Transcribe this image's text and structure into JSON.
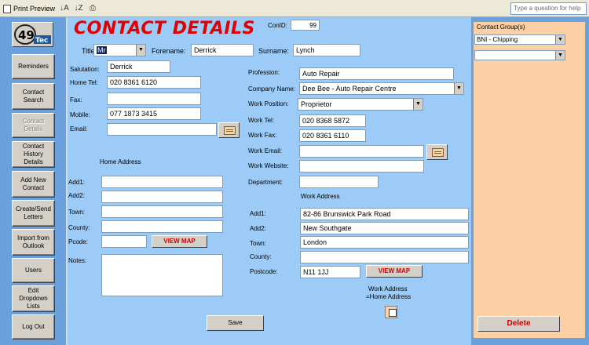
{
  "toolbar": {
    "print_preview": "Print Preview",
    "sort_asc_icon": "sort-ascending-icon",
    "sort_desc_icon": "sort-descending-icon",
    "printer_icon": "printer-icon",
    "help_placeholder": "Type a question for help"
  },
  "logo": {
    "number": "49",
    "text": "Tec"
  },
  "nav": {
    "reminders": "Reminders",
    "contact_search": "Contact Search",
    "contact_details": "Contact Details",
    "contact_history": "Contact History Details",
    "add_new_contact": "Add New Contact",
    "create_send_letters": "Create/Send Letters",
    "import_outlook": "Import from Outlook",
    "users": "Users",
    "edit_dropdown": "Edit Dropdown Lists",
    "log_out": "Log Out"
  },
  "header": {
    "title": "CONTACT DETAILS",
    "conid_label": "ConID:",
    "conid_value": "99"
  },
  "name": {
    "title_label": "Title:",
    "title_value": "Mr",
    "forename_label": "Forename:",
    "forename_value": "Derrick",
    "surname_label": "Surname:",
    "surname_value": "Lynch"
  },
  "personal": {
    "salutation_label": "Salutation:",
    "salutation_value": "Derrick",
    "home_tel_label": "Home Tel:",
    "home_tel_value": "020 8361 6120",
    "fax_label": "Fax:",
    "fax_value": "",
    "mobile_label": "Mobile:",
    "mobile_value": "077 1873 3415",
    "email_label": "Email:",
    "email_value": ""
  },
  "home_address": {
    "heading": "Home Address",
    "add1_label": "Add1:",
    "add1_value": "",
    "add2_label": "Add2:",
    "add2_value": "",
    "town_label": "Town:",
    "town_value": "",
    "county_label": "County:",
    "county_value": "",
    "pcode_label": "Pcode:",
    "pcode_value": "",
    "view_map": "VIEW MAP",
    "notes_label": "Notes:",
    "notes_value": ""
  },
  "work": {
    "profession_label": "Profession:",
    "profession_value": "Auto Repair",
    "company_label": "Company Name:",
    "company_value": "Dee Bee - Auto Repair Centre",
    "position_label": "Work Position:",
    "position_value": "Proprietor",
    "tel_label": "Work Tel:",
    "tel_value": "020 8368 5872",
    "fax_label": "Work Fax:",
    "fax_value": "020 8361 6110",
    "email_label": "Work Email:",
    "email_value": "",
    "website_label": "Work Website:",
    "website_value": "",
    "department_label": "Department:",
    "department_value": ""
  },
  "work_address": {
    "heading": "Work Address",
    "add1_label": "Add1:",
    "add1_value": "82-86 Brunswick Park Road",
    "add2_label": "Add2:",
    "add2_value": "New Southgate",
    "town_label": "Town:",
    "town_value": "London",
    "county_label": "County:",
    "county_value": "",
    "postcode_label": "Postcode:",
    "postcode_value": "N11 1JJ",
    "view_map": "VIEW MAP",
    "same_as_home_line1": "Work Address",
    "same_as_home_line2": "=Home Address"
  },
  "actions": {
    "save": "Save",
    "delete": "Delete"
  },
  "groups": {
    "heading": "Contact Group(s)",
    "group1_value": "BNI - Chipping",
    "group2_value": ""
  },
  "colors": {
    "form_bg": "#9ccbf7",
    "nav_bg": "#6aa0dc",
    "title_red": "#e00000",
    "group_panel": "#fcd0a4"
  }
}
